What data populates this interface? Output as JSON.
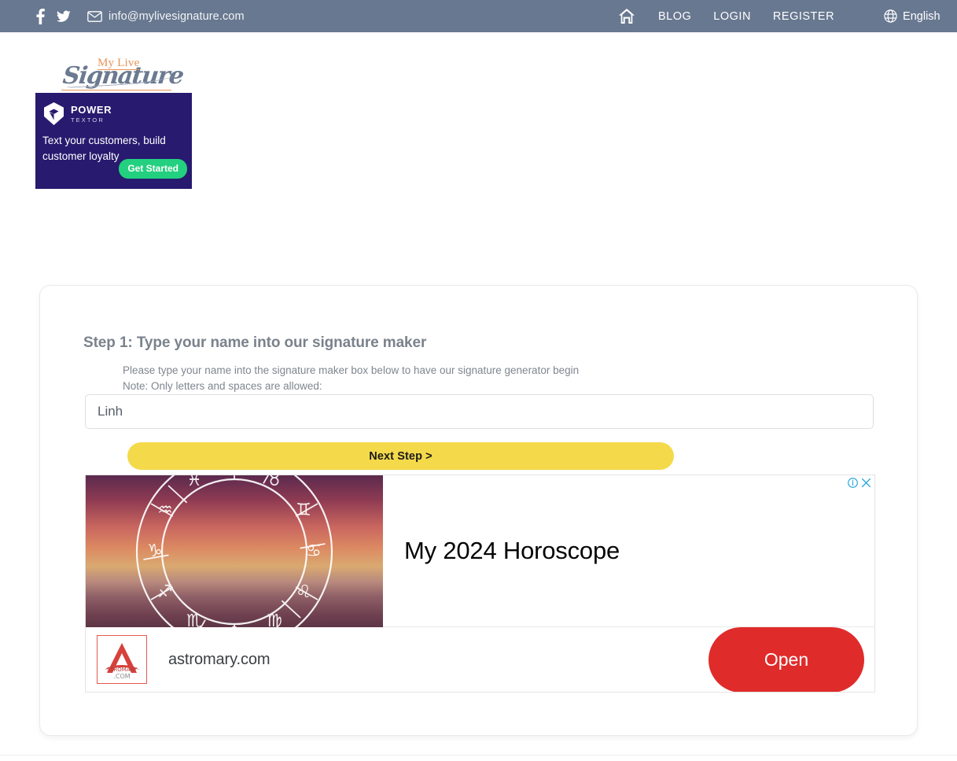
{
  "topbar": {
    "email": "info@mylivesignature.com",
    "nav": [
      {
        "label": "BLOG"
      },
      {
        "label": "LOGIN"
      },
      {
        "label": "REGISTER"
      }
    ],
    "language": "English",
    "bg_color": "#687890"
  },
  "logo": {
    "tagline": "My Live",
    "wordmark": "Signature",
    "accent_color": "#e8945a",
    "script_color": "#6b7a90"
  },
  "sidebar_ad": {
    "brand_line1": "POWER",
    "brand_line2": "TEXTOR",
    "copy": "Text your customers, build customer loyalty",
    "cta": "Get Started",
    "bg_color": "#281a6e",
    "cta_color": "#22d07f"
  },
  "main": {
    "step_title": "Step 1: Type your name into our signature maker",
    "description_line1": "Please type your name into the signature maker box below to have our signature generator begin",
    "description_line2": "Note: Only letters and spaces are allowed:",
    "input_value": "Linh",
    "input_placeholder": "",
    "next_button": "Next Step >",
    "next_button_color": "#f4d94b"
  },
  "google_ad": {
    "headline": "My 2024 Horoscope",
    "advertiser": "astromary.com",
    "cta": "Open",
    "cta_color": "#e02b2b",
    "info_icon": "info-circle-icon",
    "close_icon": "close-icon"
  }
}
